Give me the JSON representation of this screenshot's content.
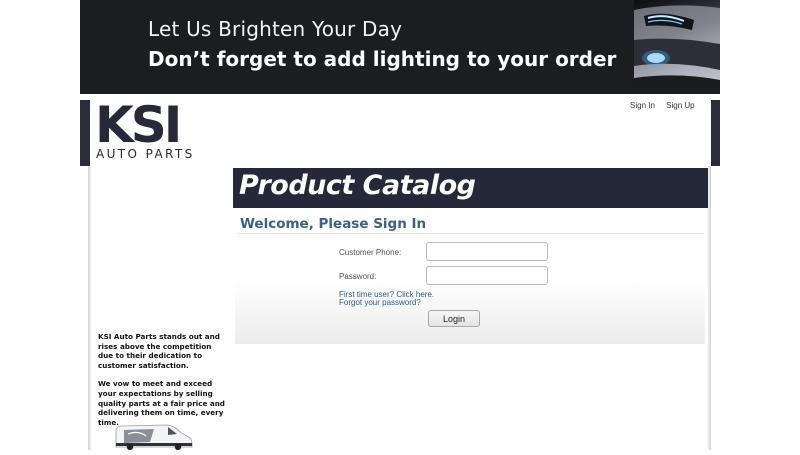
{
  "banner": {
    "line1": "Let Us Brighten Your Day",
    "line2": "Don’t forget to add lighting to your order"
  },
  "logo": {
    "main": "KSI",
    "sub": "AUTO PARTS"
  },
  "top_links": {
    "sign_in": "Sign In",
    "sign_up": "Sign Up"
  },
  "catalog": {
    "title": "Product Catalog"
  },
  "login": {
    "heading": "Welcome, Please Sign In",
    "phone_label": "Customer Phone:",
    "phone_value": "",
    "password_label": "Password:",
    "password_value": "",
    "first_time_link": "First time user? Click here.",
    "forgot_link": "Forgot your password?",
    "button_label": "Login"
  },
  "about": {
    "p1": "KSI Auto Parts stands out and rises above the competition due to their dedication to customer satisfaction.",
    "p2": "We vow to meet and exceed your expectations by selling quality parts at a fair price and delivering them on time, every time."
  },
  "colors": {
    "brand_dark": "#252838",
    "link_blue": "#2d5b92",
    "heading_blue": "#3b5f8e"
  }
}
